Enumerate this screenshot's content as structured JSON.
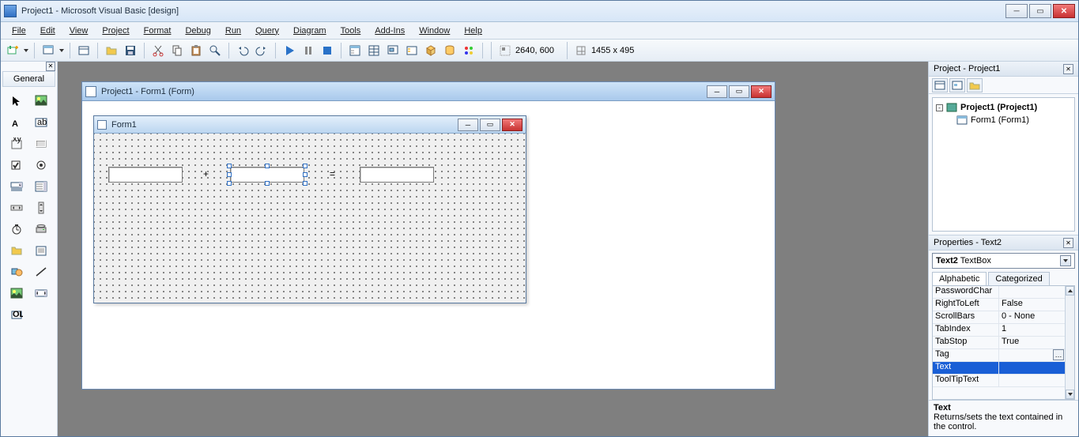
{
  "window": {
    "title": "Project1 - Microsoft Visual Basic [design]",
    "min": "─",
    "max": "▭",
    "close": "✕"
  },
  "menu": {
    "items": [
      "File",
      "Edit",
      "View",
      "Project",
      "Format",
      "Debug",
      "Run",
      "Query",
      "Diagram",
      "Tools",
      "Add-Ins",
      "Window",
      "Help"
    ]
  },
  "toolbar": {
    "pos": "2640, 600",
    "size": "1455 x 495"
  },
  "toolbox": {
    "header": "General"
  },
  "designer": {
    "title": "Project1 - Form1 (Form)",
    "min": "─",
    "max": "▭",
    "close": "✕"
  },
  "form": {
    "title": "Form1",
    "min": "─",
    "max": "▭",
    "close": "✕",
    "label_plus": "+",
    "label_equals": "=",
    "text1": "",
    "text2": "",
    "text3": ""
  },
  "project_panel": {
    "title": "Project - Project1",
    "root": "Project1 (Project1)",
    "form": "Form1 (Form1)"
  },
  "properties_panel": {
    "title": "Properties - Text2",
    "object_name": "Text2",
    "object_type": "TextBox",
    "tabs": {
      "alpha": "Alphabetic",
      "cat": "Categorized"
    },
    "rows": [
      {
        "name": "PasswordChar",
        "value": ""
      },
      {
        "name": "RightToLeft",
        "value": "False"
      },
      {
        "name": "ScrollBars",
        "value": "0 - None"
      },
      {
        "name": "TabIndex",
        "value": "1"
      },
      {
        "name": "TabStop",
        "value": "True"
      },
      {
        "name": "Tag",
        "value": "",
        "ellipsis": true
      },
      {
        "name": "Text",
        "value": "",
        "selected": true
      },
      {
        "name": "ToolTipText",
        "value": ""
      }
    ],
    "desc_title": "Text",
    "desc_body": "Returns/sets the text contained in the control."
  }
}
